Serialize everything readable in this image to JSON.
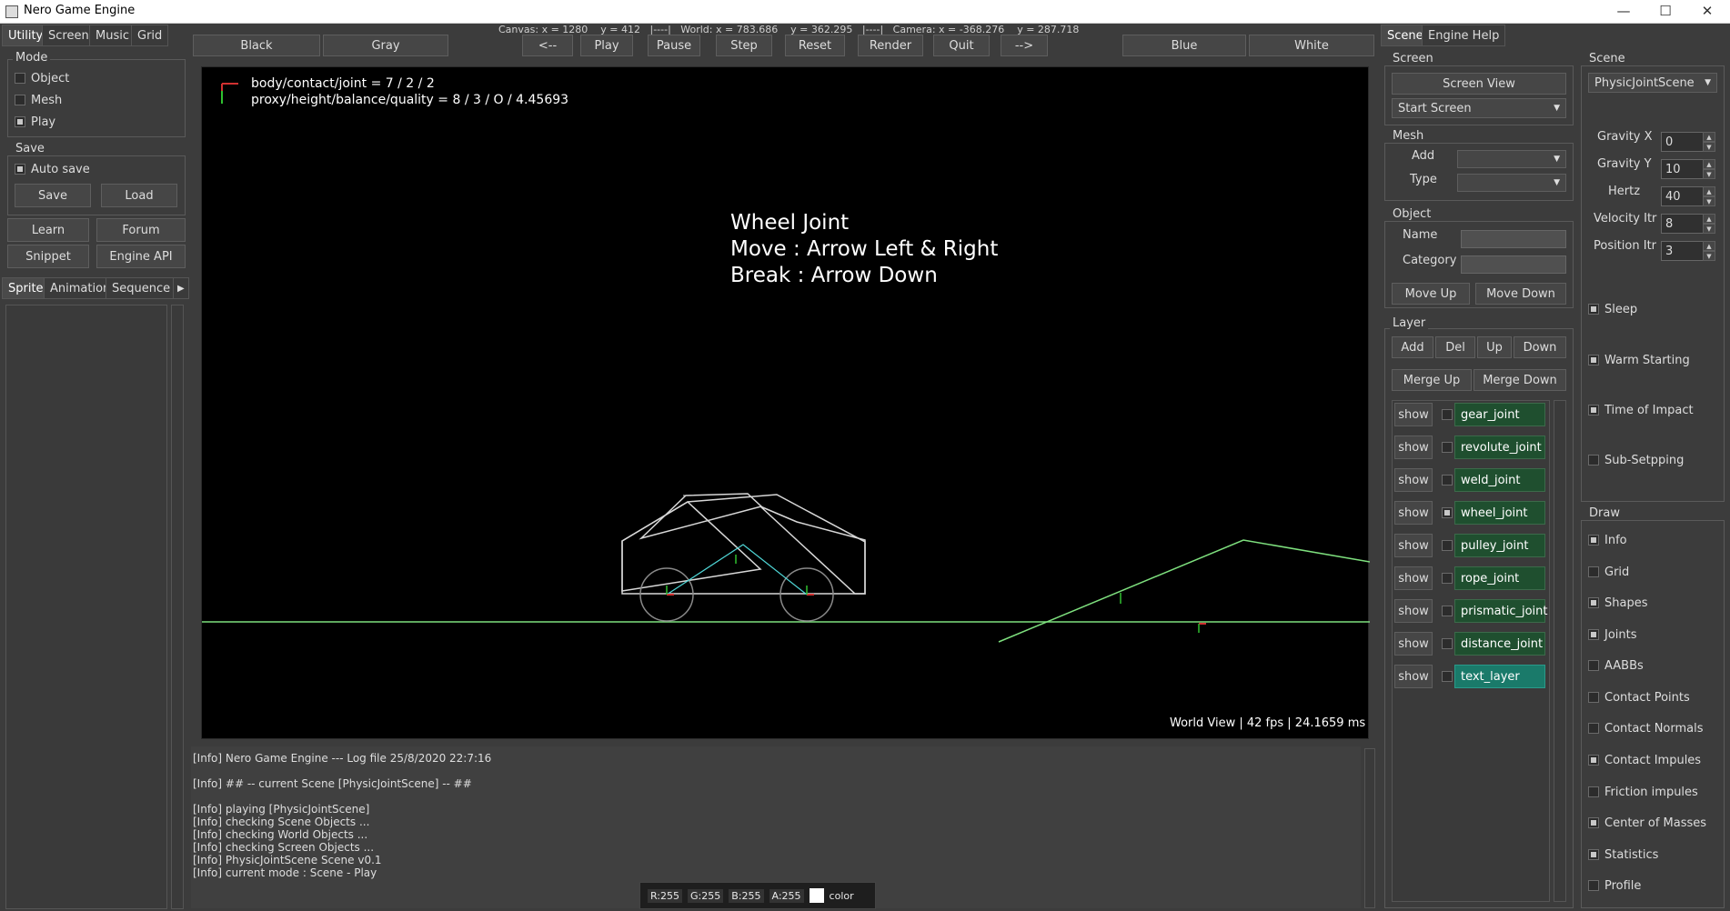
{
  "window": {
    "title": "Nero Game Engine",
    "minimize": "—",
    "maximize": "☐",
    "close": "✕"
  },
  "left_tabs": [
    "Utility",
    "Screen",
    "Music",
    "Grid"
  ],
  "mode": {
    "label": "Mode",
    "items": [
      {
        "label": "Object",
        "checked": false
      },
      {
        "label": "Mesh",
        "checked": false
      },
      {
        "label": "Play",
        "checked": true
      }
    ]
  },
  "save": {
    "label": "Save",
    "auto_save": "Auto save",
    "auto_checked": true,
    "save_btn": "Save",
    "load_btn": "Load"
  },
  "links": {
    "learn": "Learn",
    "forum": "Forum",
    "snippet": "Snippet",
    "engine_api": "Engine API"
  },
  "resource_tabs": [
    "Sprite",
    "Animation",
    "Sequence"
  ],
  "resource_more": "▶",
  "status_bar": "Canvas: x = 1280    y = 412   |----|   World: x = 783.686    y = 362.295   |----|   Camera: x = -368.276    y = 287.718",
  "toolbar": {
    "black": "Black",
    "gray": "Gray",
    "prev": "<--",
    "play": "Play",
    "pause": "Pause",
    "step": "Step",
    "reset": "Reset",
    "render": "Render",
    "quit": "Quit",
    "next": "-->",
    "blue": "Blue",
    "white": "White"
  },
  "viewport": {
    "stats_line1": "body/contact/joint = 7 / 2 / 2",
    "stats_line2": "proxy/height/balance/quality = 8 / 3 / O / 4.45693",
    "info_title": "Wheel Joint",
    "info_move": "Move : Arrow Left & Right",
    "info_break": "Break : Arrow Down",
    "footer": "World View  |  42 fps  |  24.1659 ms"
  },
  "log": [
    "[Info] Nero Game Engine --- Log file 25/8/2020 22:7:16",
    "",
    "[Info] ## -- current Scene [PhysicJointScene] -- ##",
    "",
    "[Info] playing [PhysicJointScene]",
    "[Info] checking Scene Objects ...",
    "[Info] checking World Objects ...",
    "[Info] checking Screen Objects ...",
    "[Info] PhysicJointScene Scene v0.1",
    "[Info] current mode : Scene - Play"
  ],
  "color_bar": {
    "r": "R:255",
    "g": "G:255",
    "b": "B:255",
    "a": "A:255",
    "label": "color"
  },
  "right_tabs": [
    "Scene",
    "Engine Help"
  ],
  "screen_group": {
    "label": "Screen",
    "screen_view": "Screen View",
    "start_screen": "Start Screen"
  },
  "mesh_group": {
    "label": "Mesh",
    "add": "Add",
    "type": "Type"
  },
  "object_group": {
    "label": "Object",
    "name": "Name",
    "category": "Category",
    "move_up": "Move Up",
    "move_down": "Move Down"
  },
  "layer_group": {
    "label": "Layer",
    "add": "Add",
    "del": "Del",
    "up": "Up",
    "down": "Down",
    "merge_up": "Merge Up",
    "merge_down": "Merge Down"
  },
  "layers": [
    {
      "show": "show",
      "name": "gear_joint",
      "checked": false
    },
    {
      "show": "show",
      "name": "revolute_joint",
      "checked": false
    },
    {
      "show": "show",
      "name": "weld_joint",
      "checked": false
    },
    {
      "show": "show",
      "name": "wheel_joint",
      "checked": true
    },
    {
      "show": "show",
      "name": "pulley_joint",
      "checked": false
    },
    {
      "show": "show",
      "name": "rope_joint",
      "checked": false
    },
    {
      "show": "show",
      "name": "prismatic_joint",
      "checked": false
    },
    {
      "show": "show",
      "name": "distance_joint",
      "checked": false
    },
    {
      "show": "show",
      "name": "text_layer",
      "checked": false
    }
  ],
  "scene_group": {
    "label": "Scene",
    "scene_select": "PhysicJointScene",
    "params": [
      {
        "label": "Gravity X",
        "value": "0"
      },
      {
        "label": "Gravity Y",
        "value": "10"
      },
      {
        "label": "Hertz",
        "value": "40"
      },
      {
        "label": "Velocity Itr",
        "value": "8"
      },
      {
        "label": "Position Itr",
        "value": "3"
      }
    ],
    "options": [
      {
        "label": "Sleep",
        "checked": true
      },
      {
        "label": "Warm Starting",
        "checked": true
      },
      {
        "label": "Time of Impact",
        "checked": true
      },
      {
        "label": "Sub-Setpping",
        "checked": false
      }
    ]
  },
  "draw_group": {
    "label": "Draw",
    "options": [
      {
        "label": "Info",
        "checked": true
      },
      {
        "label": "Grid",
        "checked": false
      },
      {
        "label": "Shapes",
        "checked": true
      },
      {
        "label": "Joints",
        "checked": true
      },
      {
        "label": "AABBs",
        "checked": false
      },
      {
        "label": "Contact Points",
        "checked": false
      },
      {
        "label": "Contact Normals",
        "checked": false
      },
      {
        "label": "Contact Impules",
        "checked": true
      },
      {
        "label": "Friction impules",
        "checked": false
      },
      {
        "label": "Center of Masses",
        "checked": true
      },
      {
        "label": "Statistics",
        "checked": true
      },
      {
        "label": "Profile",
        "checked": false
      }
    ]
  },
  "colors": {
    "ground": "#7ee07e",
    "body": "#d8d8d8",
    "joint": "#4fd6d6",
    "viewport_bg": "#000000",
    "layer_bg": "#1f4f2f",
    "layer_sel": "#1a7a6a"
  }
}
